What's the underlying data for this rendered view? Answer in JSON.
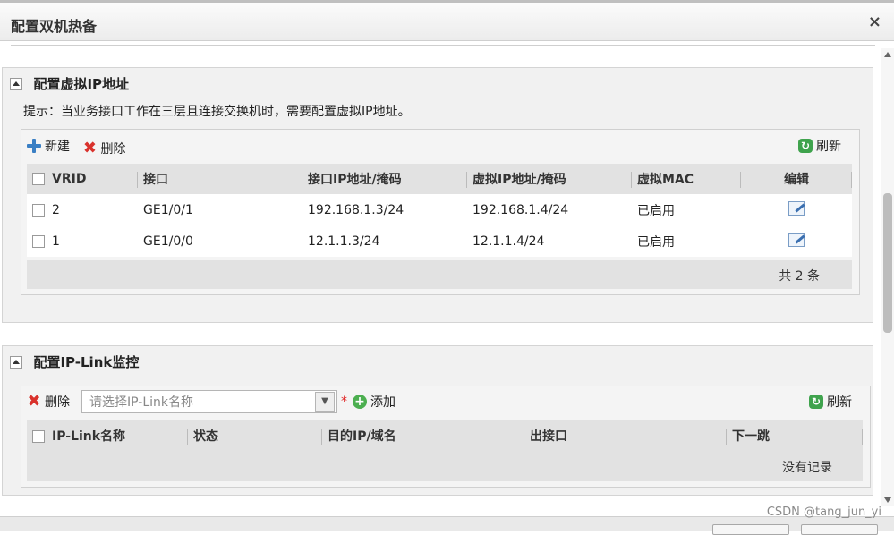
{
  "window": {
    "title": "配置双机热备",
    "close_label": "×"
  },
  "vip_panel": {
    "title": "配置虚拟IP地址",
    "hint": "提示：当业务接口工作在三层且连接交换机时，需要配置虚拟IP地址。",
    "toolbar": {
      "new_label": "新建",
      "delete_label": "删除",
      "refresh_label": "刷新"
    },
    "columns": [
      "VRID",
      "接口",
      "接口IP地址/掩码",
      "虚拟IP地址/掩码",
      "虚拟MAC",
      "编辑"
    ],
    "rows": [
      {
        "vrid": "2",
        "iface": "GE1/0/1",
        "iface_ip": "192.168.1.3/24",
        "vip": "192.168.1.4/24",
        "vmac": "已启用"
      },
      {
        "vrid": "1",
        "iface": "GE1/0/0",
        "iface_ip": "12.1.1.3/24",
        "vip": "12.1.1.4/24",
        "vmac": "已启用"
      }
    ],
    "total": "共 2 条"
  },
  "iplink_panel": {
    "title": "配置IP-Link监控",
    "toolbar": {
      "delete_label": "删除",
      "select_placeholder": "请选择IP-Link名称",
      "required_mark": "*",
      "add_label": "添加",
      "refresh_label": "刷新"
    },
    "columns": [
      "IP-Link名称",
      "状态",
      "目的IP/域名",
      "出接口",
      "下一跳"
    ],
    "empty_text": "没有记录"
  },
  "watermark": "CSDN @tang_jun_yi",
  "colors": {
    "accent_blue": "#3a7fc4",
    "delete_red": "#d9322c",
    "refresh_green": "#3fa34d"
  }
}
